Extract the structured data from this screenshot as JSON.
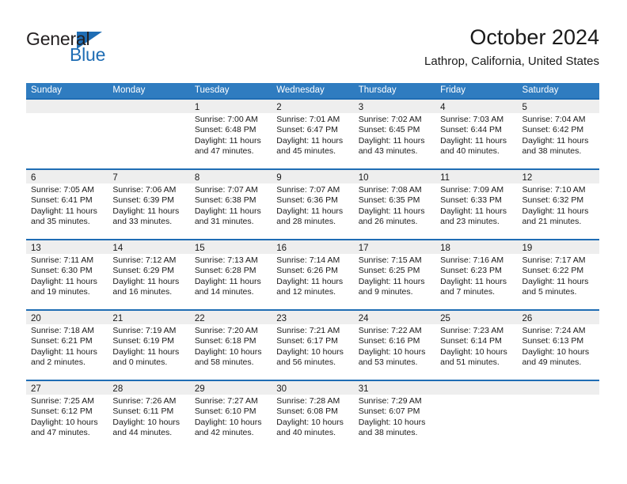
{
  "logo": {
    "word_one": "General",
    "word_two": "Blue",
    "triangle_icon": "triangle-icon",
    "accent_color": "#1f6db4"
  },
  "header": {
    "month_title": "October 2024",
    "location": "Lathrop, California, United States"
  },
  "theme": {
    "header_blue": "#2f7cc0",
    "row_border_blue": "#1f6db4",
    "date_band_gray": "#eeeeee"
  },
  "calendar": {
    "weekdays": [
      "Sunday",
      "Monday",
      "Tuesday",
      "Wednesday",
      "Thursday",
      "Friday",
      "Saturday"
    ],
    "weeks": [
      [
        {
          "day": "",
          "sunrise": "",
          "sunset": "",
          "daylight_line1": "",
          "daylight_line2": ""
        },
        {
          "day": "",
          "sunrise": "",
          "sunset": "",
          "daylight_line1": "",
          "daylight_line2": ""
        },
        {
          "day": "1",
          "sunrise": "Sunrise: 7:00 AM",
          "sunset": "Sunset: 6:48 PM",
          "daylight_line1": "Daylight: 11 hours",
          "daylight_line2": "and 47 minutes."
        },
        {
          "day": "2",
          "sunrise": "Sunrise: 7:01 AM",
          "sunset": "Sunset: 6:47 PM",
          "daylight_line1": "Daylight: 11 hours",
          "daylight_line2": "and 45 minutes."
        },
        {
          "day": "3",
          "sunrise": "Sunrise: 7:02 AM",
          "sunset": "Sunset: 6:45 PM",
          "daylight_line1": "Daylight: 11 hours",
          "daylight_line2": "and 43 minutes."
        },
        {
          "day": "4",
          "sunrise": "Sunrise: 7:03 AM",
          "sunset": "Sunset: 6:44 PM",
          "daylight_line1": "Daylight: 11 hours",
          "daylight_line2": "and 40 minutes."
        },
        {
          "day": "5",
          "sunrise": "Sunrise: 7:04 AM",
          "sunset": "Sunset: 6:42 PM",
          "daylight_line1": "Daylight: 11 hours",
          "daylight_line2": "and 38 minutes."
        }
      ],
      [
        {
          "day": "6",
          "sunrise": "Sunrise: 7:05 AM",
          "sunset": "Sunset: 6:41 PM",
          "daylight_line1": "Daylight: 11 hours",
          "daylight_line2": "and 35 minutes."
        },
        {
          "day": "7",
          "sunrise": "Sunrise: 7:06 AM",
          "sunset": "Sunset: 6:39 PM",
          "daylight_line1": "Daylight: 11 hours",
          "daylight_line2": "and 33 minutes."
        },
        {
          "day": "8",
          "sunrise": "Sunrise: 7:07 AM",
          "sunset": "Sunset: 6:38 PM",
          "daylight_line1": "Daylight: 11 hours",
          "daylight_line2": "and 31 minutes."
        },
        {
          "day": "9",
          "sunrise": "Sunrise: 7:07 AM",
          "sunset": "Sunset: 6:36 PM",
          "daylight_line1": "Daylight: 11 hours",
          "daylight_line2": "and 28 minutes."
        },
        {
          "day": "10",
          "sunrise": "Sunrise: 7:08 AM",
          "sunset": "Sunset: 6:35 PM",
          "daylight_line1": "Daylight: 11 hours",
          "daylight_line2": "and 26 minutes."
        },
        {
          "day": "11",
          "sunrise": "Sunrise: 7:09 AM",
          "sunset": "Sunset: 6:33 PM",
          "daylight_line1": "Daylight: 11 hours",
          "daylight_line2": "and 23 minutes."
        },
        {
          "day": "12",
          "sunrise": "Sunrise: 7:10 AM",
          "sunset": "Sunset: 6:32 PM",
          "daylight_line1": "Daylight: 11 hours",
          "daylight_line2": "and 21 minutes."
        }
      ],
      [
        {
          "day": "13",
          "sunrise": "Sunrise: 7:11 AM",
          "sunset": "Sunset: 6:30 PM",
          "daylight_line1": "Daylight: 11 hours",
          "daylight_line2": "and 19 minutes."
        },
        {
          "day": "14",
          "sunrise": "Sunrise: 7:12 AM",
          "sunset": "Sunset: 6:29 PM",
          "daylight_line1": "Daylight: 11 hours",
          "daylight_line2": "and 16 minutes."
        },
        {
          "day": "15",
          "sunrise": "Sunrise: 7:13 AM",
          "sunset": "Sunset: 6:28 PM",
          "daylight_line1": "Daylight: 11 hours",
          "daylight_line2": "and 14 minutes."
        },
        {
          "day": "16",
          "sunrise": "Sunrise: 7:14 AM",
          "sunset": "Sunset: 6:26 PM",
          "daylight_line1": "Daylight: 11 hours",
          "daylight_line2": "and 12 minutes."
        },
        {
          "day": "17",
          "sunrise": "Sunrise: 7:15 AM",
          "sunset": "Sunset: 6:25 PM",
          "daylight_line1": "Daylight: 11 hours",
          "daylight_line2": "and 9 minutes."
        },
        {
          "day": "18",
          "sunrise": "Sunrise: 7:16 AM",
          "sunset": "Sunset: 6:23 PM",
          "daylight_line1": "Daylight: 11 hours",
          "daylight_line2": "and 7 minutes."
        },
        {
          "day": "19",
          "sunrise": "Sunrise: 7:17 AM",
          "sunset": "Sunset: 6:22 PM",
          "daylight_line1": "Daylight: 11 hours",
          "daylight_line2": "and 5 minutes."
        }
      ],
      [
        {
          "day": "20",
          "sunrise": "Sunrise: 7:18 AM",
          "sunset": "Sunset: 6:21 PM",
          "daylight_line1": "Daylight: 11 hours",
          "daylight_line2": "and 2 minutes."
        },
        {
          "day": "21",
          "sunrise": "Sunrise: 7:19 AM",
          "sunset": "Sunset: 6:19 PM",
          "daylight_line1": "Daylight: 11 hours",
          "daylight_line2": "and 0 minutes."
        },
        {
          "day": "22",
          "sunrise": "Sunrise: 7:20 AM",
          "sunset": "Sunset: 6:18 PM",
          "daylight_line1": "Daylight: 10 hours",
          "daylight_line2": "and 58 minutes."
        },
        {
          "day": "23",
          "sunrise": "Sunrise: 7:21 AM",
          "sunset": "Sunset: 6:17 PM",
          "daylight_line1": "Daylight: 10 hours",
          "daylight_line2": "and 56 minutes."
        },
        {
          "day": "24",
          "sunrise": "Sunrise: 7:22 AM",
          "sunset": "Sunset: 6:16 PM",
          "daylight_line1": "Daylight: 10 hours",
          "daylight_line2": "and 53 minutes."
        },
        {
          "day": "25",
          "sunrise": "Sunrise: 7:23 AM",
          "sunset": "Sunset: 6:14 PM",
          "daylight_line1": "Daylight: 10 hours",
          "daylight_line2": "and 51 minutes."
        },
        {
          "day": "26",
          "sunrise": "Sunrise: 7:24 AM",
          "sunset": "Sunset: 6:13 PM",
          "daylight_line1": "Daylight: 10 hours",
          "daylight_line2": "and 49 minutes."
        }
      ],
      [
        {
          "day": "27",
          "sunrise": "Sunrise: 7:25 AM",
          "sunset": "Sunset: 6:12 PM",
          "daylight_line1": "Daylight: 10 hours",
          "daylight_line2": "and 47 minutes."
        },
        {
          "day": "28",
          "sunrise": "Sunrise: 7:26 AM",
          "sunset": "Sunset: 6:11 PM",
          "daylight_line1": "Daylight: 10 hours",
          "daylight_line2": "and 44 minutes."
        },
        {
          "day": "29",
          "sunrise": "Sunrise: 7:27 AM",
          "sunset": "Sunset: 6:10 PM",
          "daylight_line1": "Daylight: 10 hours",
          "daylight_line2": "and 42 minutes."
        },
        {
          "day": "30",
          "sunrise": "Sunrise: 7:28 AM",
          "sunset": "Sunset: 6:08 PM",
          "daylight_line1": "Daylight: 10 hours",
          "daylight_line2": "and 40 minutes."
        },
        {
          "day": "31",
          "sunrise": "Sunrise: 7:29 AM",
          "sunset": "Sunset: 6:07 PM",
          "daylight_line1": "Daylight: 10 hours",
          "daylight_line2": "and 38 minutes."
        },
        {
          "day": "",
          "sunrise": "",
          "sunset": "",
          "daylight_line1": "",
          "daylight_line2": ""
        },
        {
          "day": "",
          "sunrise": "",
          "sunset": "",
          "daylight_line1": "",
          "daylight_line2": ""
        }
      ]
    ]
  }
}
